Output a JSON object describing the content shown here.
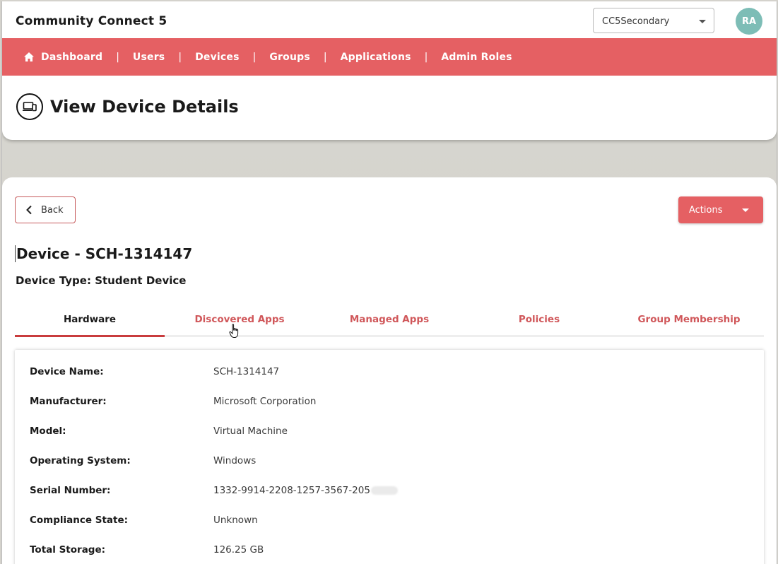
{
  "app": {
    "title": "Community Connect 5",
    "tenant_selected": "CC5Secondary",
    "avatar_initials": "RA",
    "accent_color": "#e56063"
  },
  "nav": {
    "items": [
      {
        "label": "Dashboard",
        "icon": "home-icon"
      },
      {
        "label": "Users"
      },
      {
        "label": "Devices"
      },
      {
        "label": "Groups"
      },
      {
        "label": "Applications"
      },
      {
        "label": "Admin Roles"
      }
    ],
    "separator": "|"
  },
  "page": {
    "title": "View Device Details",
    "icon": "device-icon"
  },
  "toolbar": {
    "back_label": "Back",
    "actions_label": "Actions"
  },
  "device": {
    "heading": "Device - SCH-1314147",
    "type_line": "Device Type: Student Device"
  },
  "tabs": [
    {
      "label": "Hardware",
      "active": true
    },
    {
      "label": "Discovered Apps",
      "active": false
    },
    {
      "label": "Managed Apps",
      "active": false
    },
    {
      "label": "Policies",
      "active": false
    },
    {
      "label": "Group Membership",
      "active": false
    }
  ],
  "details": [
    {
      "label": "Device Name:",
      "value": "SCH-1314147"
    },
    {
      "label": "Manufacturer:",
      "value": "Microsoft Corporation"
    },
    {
      "label": "Model:",
      "value": "Virtual Machine"
    },
    {
      "label": "Operating System:",
      "value": "Windows"
    },
    {
      "label": "Serial Number:",
      "value": "1332-9914-2208-1257-3567-205"
    },
    {
      "label": "Compliance State:",
      "value": "Unknown"
    },
    {
      "label": "Total Storage:",
      "value": "126.25 GB"
    }
  ]
}
